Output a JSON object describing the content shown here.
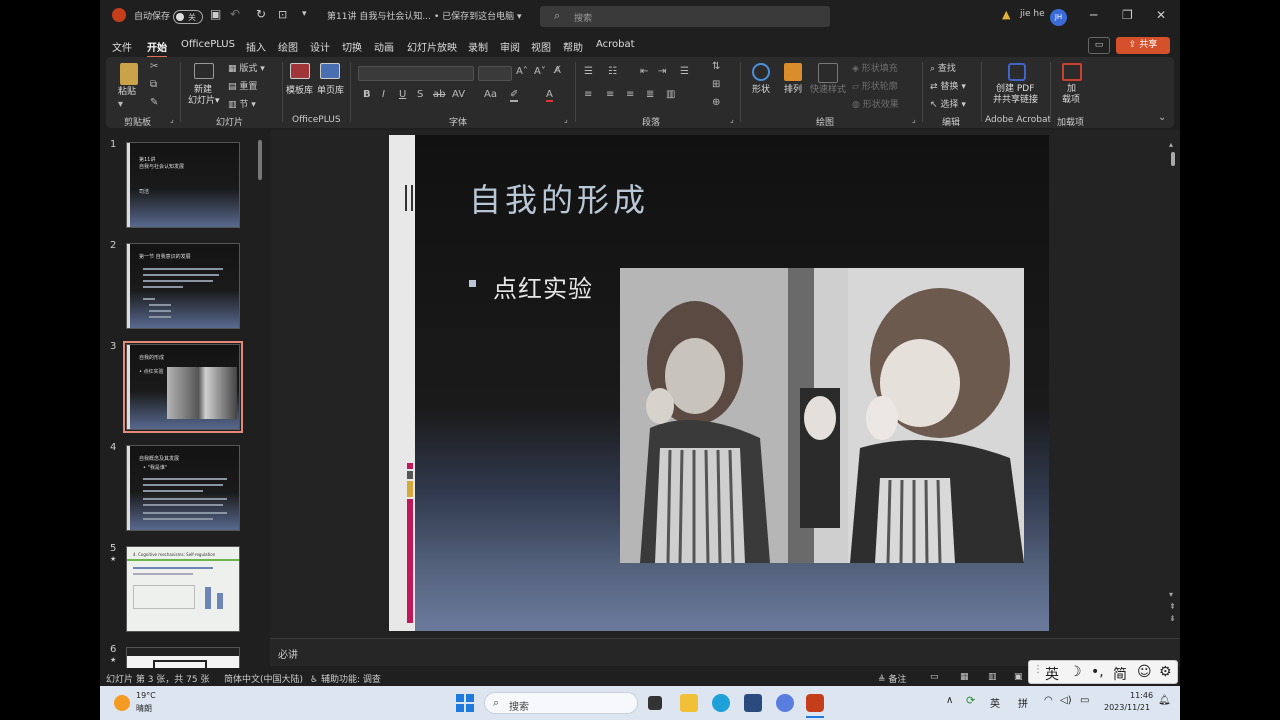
{
  "titlebar": {
    "autosave_label": "自动保存",
    "autosave_state": "关",
    "doc_title": "第11讲 自我与社会认知...",
    "save_status": "• 已保存到这台电脑",
    "search_placeholder": "搜索",
    "user_name": "jie he",
    "user_initials": "JH"
  },
  "menu": {
    "tabs": [
      "文件",
      "开始",
      "OfficePLUS",
      "插入",
      "绘图",
      "设计",
      "切换",
      "动画",
      "幻灯片放映",
      "录制",
      "审阅",
      "视图",
      "帮助",
      "Acrobat"
    ],
    "active_tab": "开始",
    "share_label": "共享"
  },
  "ribbon": {
    "clipboard": {
      "paste": "粘贴",
      "group": "剪贴板"
    },
    "slides": {
      "new_slide_line1": "新建",
      "new_slide_line2": "幻灯片",
      "layout": "版式",
      "reset": "重置",
      "section": "节",
      "group": "幻灯片"
    },
    "officeplus": {
      "template": "模板库",
      "single_page": "单页库",
      "group": "OfficePLUS"
    },
    "font": {
      "group": "字体"
    },
    "paragraph": {
      "group": "段落"
    },
    "drawing": {
      "shape": "形状",
      "arrange": "排列",
      "quick_styles": "快速样式",
      "shape_fill": "形状填充",
      "shape_outline": "形状轮廓",
      "shape_effects": "形状效果",
      "group": "绘图"
    },
    "editing": {
      "find": "查找",
      "replace": "替换",
      "select": "选择",
      "group": "编辑"
    },
    "acrobat": {
      "create_pdf_line1": "创建 PDF",
      "create_pdf_line2": "并共享链接",
      "group": "Adobe Acrobat"
    },
    "addins": {
      "addin_line1": "加",
      "addin_line2": "载项",
      "group": "加载项"
    }
  },
  "thumbnails": [
    {
      "num": "1",
      "title_line1": "第11讲",
      "title_line2": "自我与社会认知发展",
      "sub": "司洁"
    },
    {
      "num": "2",
      "title_line1": "第一节  自我意识的发展"
    },
    {
      "num": "3",
      "title_line1": "自我的形成",
      "sub": "• 点红实验"
    },
    {
      "num": "4",
      "title_line1": "自我概念及其发展",
      "sub": "• \"我是谁\""
    },
    {
      "num": "5",
      "title_line1": "4. Cognitive mechanisms: Self-regulation"
    },
    {
      "num": "6"
    }
  ],
  "slide": {
    "title": "自我的形成",
    "bullet": "点红实验"
  },
  "notes": {
    "text": "必讲"
  },
  "status": {
    "slide_info": "幻灯片 第 3 张，共 75 张",
    "language": "简体中文(中国大陆)",
    "accessibility": "辅助功能: 调查",
    "notes_btn": "备注"
  },
  "ime": {
    "mode": "英",
    "simplified": "简"
  },
  "taskbar": {
    "weather_temp": "19°C",
    "weather_desc": "晴朗",
    "search_placeholder": "搜索",
    "lang1": "英",
    "lang2": "拼",
    "time": "11:46",
    "date": "2023/11/21"
  },
  "colors": {
    "accent": "#d4512c",
    "slide_title": "#b8c6d6",
    "selected_thumb": "#e48a7a"
  }
}
